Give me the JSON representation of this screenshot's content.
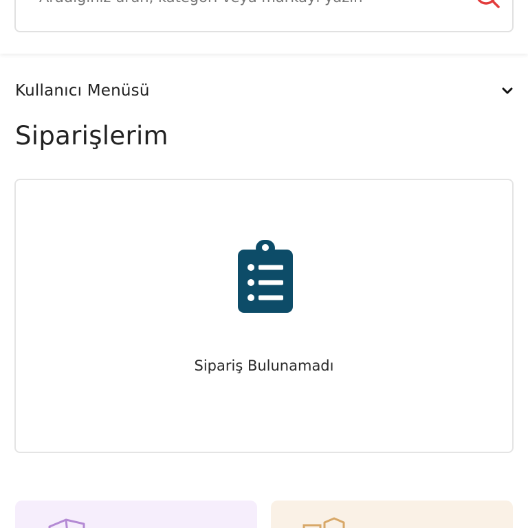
{
  "search": {
    "placeholder": "Aradığınız ürün, kategori veya markayı yazın"
  },
  "user_menu": {
    "label": "Kullanıcı Menüsü"
  },
  "page": {
    "title": "Siparişlerim"
  },
  "orders": {
    "empty_message": "Sipariş Bulunamadı"
  },
  "icons": {
    "search": "search-icon",
    "chevron": "chevron-down-icon",
    "clipboard": "clipboard-list-icon",
    "box": "box-icon",
    "hand-package": "hand-package-icon"
  },
  "colors": {
    "search_icon": "#e23b3b",
    "clipboard_icon": "#0d4c68",
    "promo_left_bg": "#f6eefc",
    "promo_right_bg": "#faf1e6",
    "promo_left_icon": "#b48ad4",
    "promo_right_icon": "#d8a868"
  }
}
